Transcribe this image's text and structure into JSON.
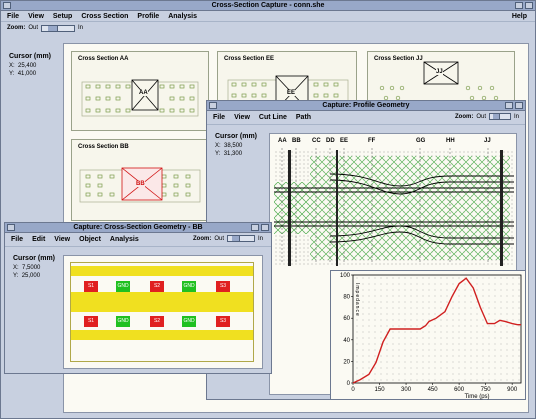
{
  "main": {
    "title": "Cross-Section Capture - conn.she",
    "menu": [
      "File",
      "View",
      "Setup",
      "Cross Section",
      "Profile",
      "Analysis"
    ],
    "help": "Help",
    "zoom_label": "Zoom:",
    "zoom_out": "Out",
    "zoom_in": "In",
    "cursor_label": "Cursor (mm)",
    "x_label": "X:",
    "y_label": "Y:",
    "x_value": "25,400",
    "y_value": "41,000",
    "sections": [
      {
        "title": "Cross Section AA",
        "marker": "AA"
      },
      {
        "title": "Cross Section EE",
        "marker": "EE"
      },
      {
        "title": "Cross Section JJ",
        "marker": "JJ"
      },
      {
        "title": "Cross Section BB",
        "marker": "BB"
      }
    ],
    "bottom_marker": "HH",
    "bottom_marker_label": "HH"
  },
  "profile": {
    "title": "Capture: Profile Geometry",
    "menu": [
      "File",
      "View",
      "Cut Line",
      "Path"
    ],
    "zoom_label": "Zoom:",
    "zoom_out": "Out",
    "zoom_in": "In",
    "cursor_label": "Cursor (mm)",
    "x_label": "X:",
    "y_label": "Y:",
    "x_value": "38,500",
    "y_value": "31,300",
    "cut_labels": [
      "AA",
      "BB",
      "CC",
      "DD",
      "EE",
      "FF",
      "GG",
      "HH",
      "JJ"
    ]
  },
  "bb": {
    "title": "Capture: Cross-Section Geometry - BB",
    "menu": [
      "File",
      "Edit",
      "View",
      "Object",
      "Analysis"
    ],
    "zoom_label": "Zoom:",
    "zoom_out": "Out",
    "zoom_in": "In",
    "cursor_label": "Cursor (mm)",
    "x_label": "X:",
    "y_label": "Y:",
    "x_value": "7,5000",
    "y_value": "25,000",
    "chips": [
      "S1",
      "GND",
      "S2",
      "GND",
      "S3"
    ]
  },
  "colors": {
    "signal": "#e02020",
    "ground": "#20c020",
    "dielectric": "#f0e020",
    "trace": "#d01010"
  },
  "chart_data": {
    "type": "line",
    "xlabel": "Time (ps)",
    "ylabel": "Impedance",
    "xlim": [
      0,
      950
    ],
    "ylim": [
      0,
      100
    ],
    "x_ticks": [
      "0",
      "150",
      "300",
      "450",
      "600",
      "750",
      "900"
    ],
    "y_ticks": [
      "0",
      "20",
      "40",
      "60",
      "80",
      "100"
    ],
    "x": [
      0,
      40,
      90,
      130,
      170,
      210,
      270,
      340,
      380,
      410,
      430,
      470,
      520,
      560,
      600,
      640,
      680,
      720,
      760,
      800,
      830,
      860,
      900,
      930,
      950
    ],
    "y": [
      0,
      3,
      8,
      19,
      38,
      50,
      50,
      50,
      50,
      53,
      57,
      60,
      66,
      80,
      92,
      97,
      88,
      70,
      55,
      55,
      58,
      57,
      55,
      54,
      54
    ]
  }
}
